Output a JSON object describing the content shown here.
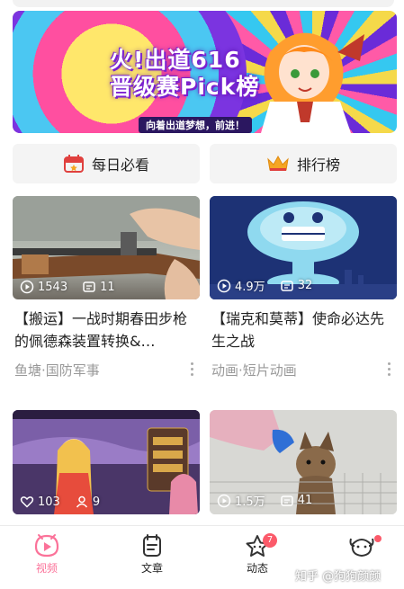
{
  "banner": {
    "title_line1": "火!出道616",
    "title_line2": "晋级赛Pick榜",
    "subtitle": "向着出道梦想，前进！"
  },
  "quick_entries": [
    {
      "label": "每日必看",
      "icon": "calendar-icon"
    },
    {
      "label": "排行榜",
      "icon": "crown-icon"
    }
  ],
  "videos": [
    {
      "plays": "1543",
      "comments": "11",
      "title": "【搬运】一战时期春田步枪的佩德森装置转换&…",
      "meta": "鱼塘·国防军事",
      "stat_icon": "play-icon"
    },
    {
      "plays": "4.9万",
      "comments": "32",
      "title": "【瑞克和莫蒂】使命必达先生之战",
      "meta": "动画·短片动画",
      "stat_icon": "play-icon"
    },
    {
      "plays": "103",
      "comments": "9",
      "title": "",
      "meta": "",
      "stat_icon": "heart-icon"
    },
    {
      "plays": "1.5万",
      "comments": "41",
      "title": "",
      "meta": "",
      "stat_icon": "play-icon"
    }
  ],
  "nav": {
    "items": [
      {
        "label": "视频",
        "icon": "video-icon",
        "active": true
      },
      {
        "label": "文章",
        "icon": "article-icon"
      },
      {
        "label": "动态",
        "icon": "star-icon",
        "badge": "7"
      },
      {
        "label": "",
        "icon": "profile-icon",
        "dot": true
      }
    ]
  },
  "watermark": "知乎 @狗狗颜颜",
  "colors": {
    "accent": "#fb7299",
    "badge": "#fb5a6a"
  }
}
